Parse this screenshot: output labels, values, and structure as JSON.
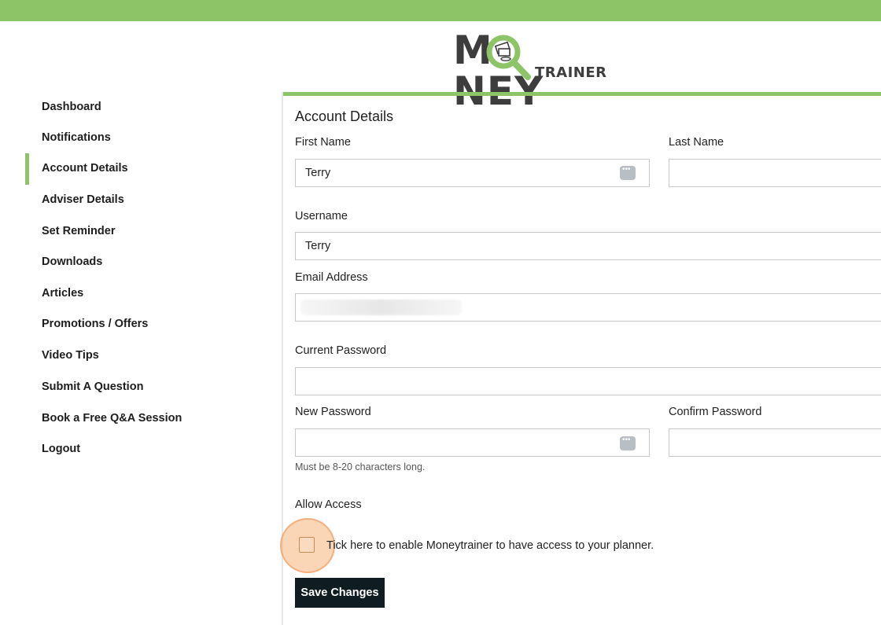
{
  "colors": {
    "accent": "#8cc467",
    "button": "#0f1d22",
    "highlight": "#f6b27a"
  },
  "logo": {
    "word_left": "M",
    "word_right": "NEY",
    "sub": "TRAINER"
  },
  "sidebar": {
    "items": [
      {
        "label": "Dashboard",
        "active": false
      },
      {
        "label": "Notifications",
        "active": false
      },
      {
        "label": "Account Details",
        "active": true
      },
      {
        "label": "Adviser Details",
        "active": false
      },
      {
        "label": "Set Reminder",
        "active": false
      },
      {
        "label": "Downloads",
        "active": false
      },
      {
        "label": "Articles",
        "active": false
      },
      {
        "label": "Promotions / Offers",
        "active": false
      },
      {
        "label": "Video Tips",
        "active": false
      },
      {
        "label": "Submit A Question",
        "active": false
      },
      {
        "label": "Book a Free Q&A Session",
        "active": false
      },
      {
        "label": "Logout",
        "active": false
      }
    ]
  },
  "form": {
    "title": "Account Details",
    "first_name": {
      "label": "First Name",
      "value": "Terry"
    },
    "last_name": {
      "label": "Last Name",
      "value": ""
    },
    "username": {
      "label": "Username",
      "value": "Terry"
    },
    "email": {
      "label": "Email Address",
      "value": ""
    },
    "current_password": {
      "label": "Current Password",
      "value": ""
    },
    "new_password": {
      "label": "New Password",
      "value": "",
      "hint": "Must be 8-20 characters long."
    },
    "confirm_password": {
      "label": "Confirm Password",
      "value": ""
    },
    "allow_access": {
      "label": "Allow Access",
      "checkbox_label": "Tick here to enable Moneytrainer to have access to your planner.",
      "checked": false
    },
    "save_label": "Save Changes"
  }
}
